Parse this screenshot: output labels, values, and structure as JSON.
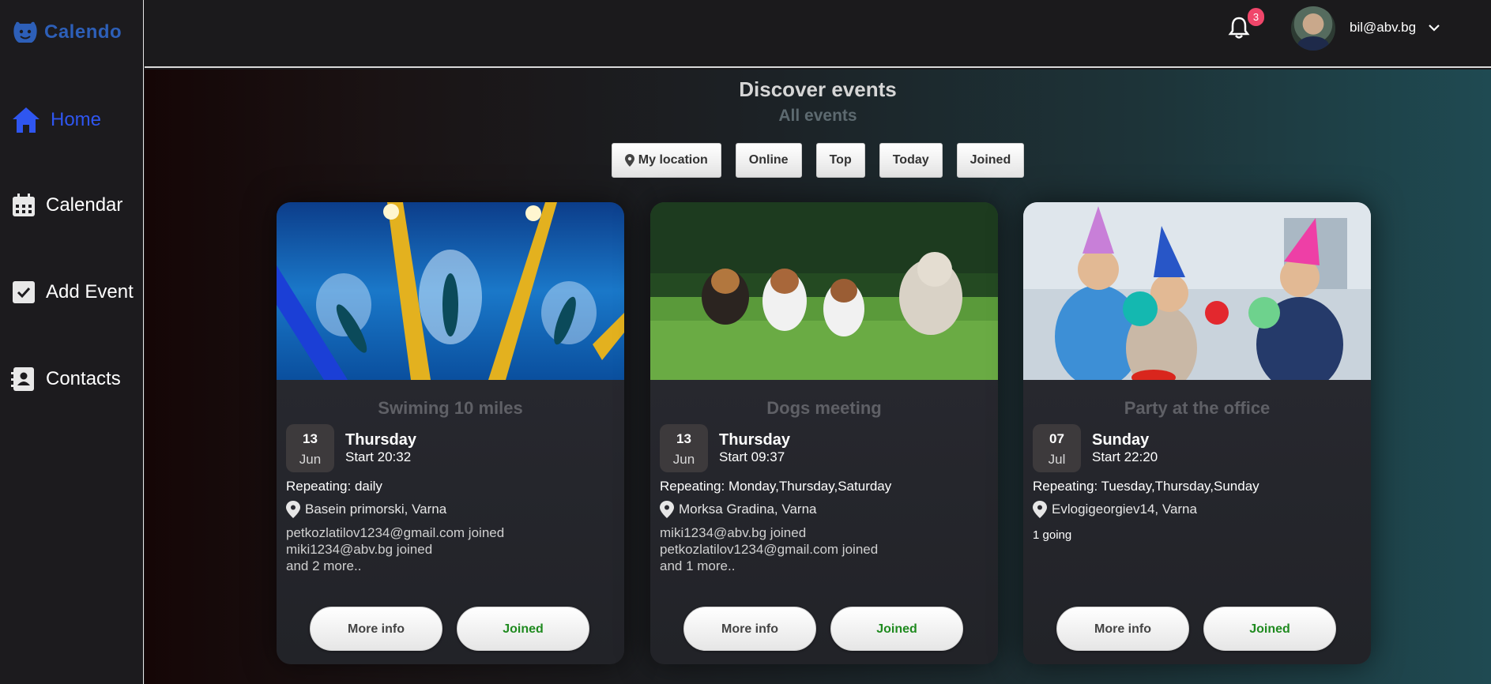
{
  "app": {
    "name": "Calendo"
  },
  "sidebar": {
    "items": [
      {
        "label": "Home",
        "icon": "home-icon",
        "active": true
      },
      {
        "label": "Calendar",
        "icon": "calendar-icon"
      },
      {
        "label": "Add Event",
        "icon": "checkbox-icon"
      },
      {
        "label": "Contacts",
        "icon": "contacts-icon"
      }
    ]
  },
  "header": {
    "notifications_count": "3",
    "user_email": "bil@abv.bg"
  },
  "main": {
    "title": "Discover events",
    "subtitle": "All events",
    "filters": [
      "My location",
      "Online",
      "Top",
      "Today",
      "Joined"
    ]
  },
  "events": [
    {
      "title": "Swiming 10 miles",
      "day": "13",
      "month": "Jun",
      "weekday": "Thursday",
      "start": "Start 20:32",
      "repeating": "Repeating: daily",
      "location": "Basein primorski, Varna",
      "joined": [
        "petkozlatilov1234@gmail.com joined",
        "miki1234@abv.bg joined",
        "and 2 more.."
      ],
      "more_label": "More info",
      "joined_label": "Joined"
    },
    {
      "title": "Dogs meeting",
      "day": "13",
      "month": "Jun",
      "weekday": "Thursday",
      "start": "Start 09:37",
      "repeating": "Repeating: Monday,Thursday,Saturday",
      "location": "Morksa Gradina, Varna",
      "joined": [
        "miki1234@abv.bg joined",
        "petkozlatilov1234@gmail.com joined",
        "and 1 more.."
      ],
      "more_label": "More info",
      "joined_label": "Joined"
    },
    {
      "title": "Party at the office",
      "day": "07",
      "month": "Jul",
      "weekday": "Sunday",
      "start": "Start 22:20",
      "repeating": "Repeating: Tuesday,Thursday,Sunday",
      "location": "Evlogigeorgiev14, Varna",
      "going": "1 going",
      "more_label": "More info",
      "joined_label": "Joined"
    }
  ],
  "colors": {
    "accent": "#2f56f0",
    "logo": "#2d5fb8",
    "badge": "#f0466a",
    "joined_text": "#1f8a1f"
  }
}
